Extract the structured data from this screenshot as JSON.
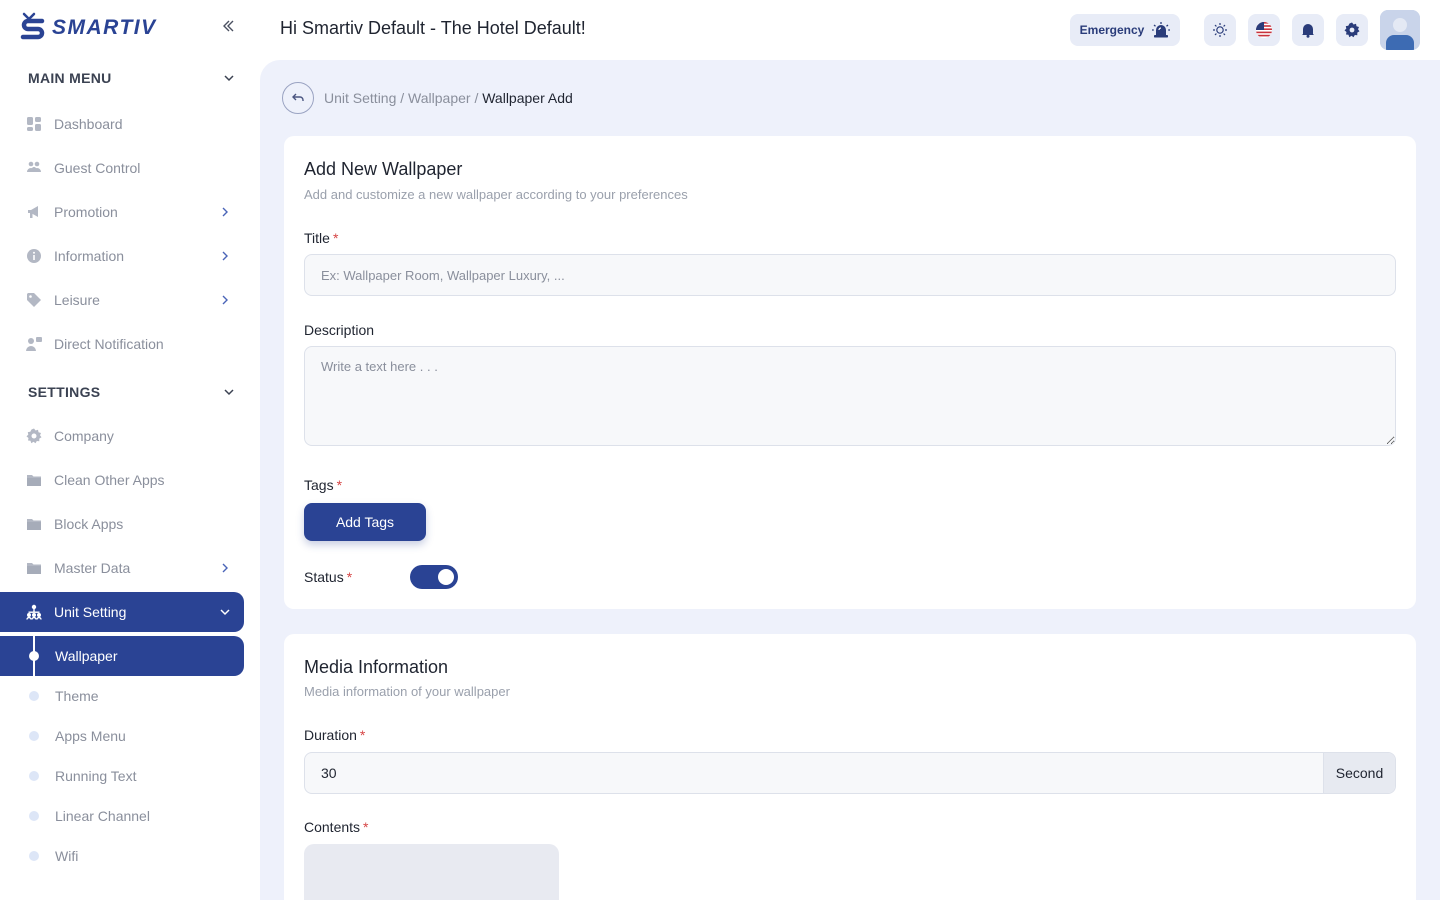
{
  "brand": {
    "name": "SMARTIV",
    "accent": "#2a4394"
  },
  "sidebar": {
    "main_menu_heading": "MAIN MENU",
    "main_menu": [
      {
        "label": "Dashboard",
        "icon": "dashboard-icon"
      },
      {
        "label": "Guest Control",
        "icon": "guests-icon"
      },
      {
        "label": "Promotion",
        "icon": "megaphone-icon",
        "has_children": true
      },
      {
        "label": "Information",
        "icon": "info-icon",
        "has_children": true
      },
      {
        "label": "Leisure",
        "icon": "tag-icon",
        "has_children": true
      },
      {
        "label": "Direct Notification",
        "icon": "notification-icon"
      }
    ],
    "settings_heading": "SETTINGS",
    "settings": [
      {
        "label": "Company",
        "icon": "gear-icon"
      },
      {
        "label": "Clean Other Apps",
        "icon": "folder-icon"
      },
      {
        "label": "Block Apps",
        "icon": "folder-icon"
      },
      {
        "label": "Master Data",
        "icon": "folder-icon",
        "has_children": true
      },
      {
        "label": "Unit Setting",
        "icon": "sitemap-icon",
        "active": true,
        "expanded": true
      }
    ],
    "unit_setting_children": [
      {
        "label": "Wallpaper",
        "active": true
      },
      {
        "label": "Theme"
      },
      {
        "label": "Apps Menu"
      },
      {
        "label": "Running Text"
      },
      {
        "label": "Linear Channel"
      },
      {
        "label": "Wifi"
      }
    ]
  },
  "header": {
    "greeting": "Hi Smartiv Default - The Hotel Default!",
    "emergency_label": "Emergency"
  },
  "breadcrumb": {
    "parts": [
      "Unit Setting",
      "Wallpaper"
    ],
    "current": "Wallpaper Add",
    "separator": "/"
  },
  "form": {
    "title": "Add New Wallpaper",
    "subtitle": "Add and customize a new wallpaper according to your preferences",
    "title_label": "Title",
    "title_placeholder": "Ex: Wallpaper Room, Wallpaper Luxury, ...",
    "description_label": "Description",
    "description_placeholder": "Write a text here . . .",
    "tags_label": "Tags",
    "add_tags_label": "Add Tags",
    "status_label": "Status",
    "status_on": true,
    "required_mark": "*"
  },
  "media": {
    "title": "Media Information",
    "subtitle": "Media information of your wallpaper",
    "duration_label": "Duration",
    "duration_value": "30",
    "duration_unit": "Second",
    "contents_label": "Contents"
  }
}
